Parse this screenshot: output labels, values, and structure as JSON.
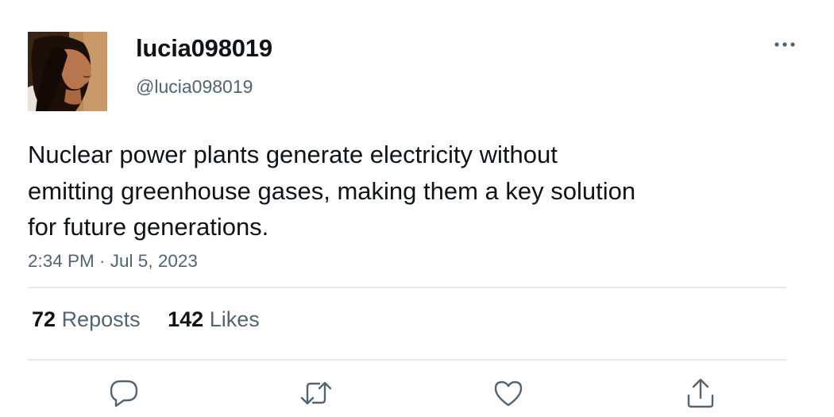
{
  "user": {
    "display_name": "lucia098019",
    "handle": "@lucia098019"
  },
  "tweet": {
    "text_lines": [
      "Nuclear power plants generate electricity without",
      "emitting greenhouse gases, making them a key solution",
      "for future generations."
    ],
    "timestamp": "2:34 PM · Jul 5, 2023"
  },
  "stats": {
    "reposts_count": "72",
    "reposts_label": "Reposts",
    "likes_count": "142",
    "likes_label": "Likes"
  },
  "actions": [
    {
      "icon": "reply-icon"
    },
    {
      "icon": "repost-icon"
    },
    {
      "icon": "like-icon"
    },
    {
      "icon": "share-icon"
    }
  ],
  "colors": {
    "primary_text": "#0f1419",
    "secondary_text": "#536471",
    "divider": "#e7e9ea",
    "background": "#ffffff"
  }
}
